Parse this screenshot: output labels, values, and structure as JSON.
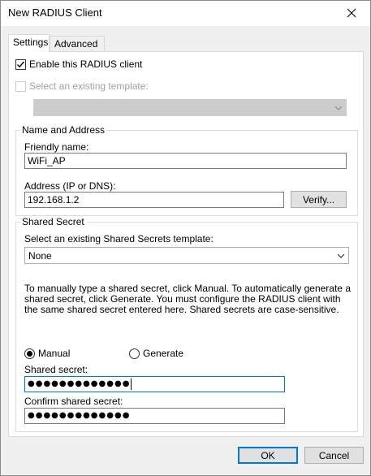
{
  "window": {
    "title": "New RADIUS Client"
  },
  "tabs": [
    {
      "label": "Settings",
      "active": true
    },
    {
      "label": "Advanced",
      "active": false
    }
  ],
  "settings": {
    "enable_client": {
      "label": "Enable this RADIUS client",
      "checked": true
    },
    "existing_template": {
      "label": "Select an existing template:",
      "checked": false,
      "enabled": false,
      "value": ""
    },
    "name_address": {
      "title": "Name and Address",
      "friendly_name_label": "Friendly name:",
      "friendly_name_value": "WiFi_AP",
      "address_label": "Address (IP or DNS):",
      "address_value": "192.168.1.2",
      "verify_label": "Verify..."
    },
    "shared_secret": {
      "title": "Shared Secret",
      "template_label": "Select an existing Shared Secrets template:",
      "template_value": "None",
      "description": "To manually type a shared secret, click Manual. To automatically generate a shared secret, click Generate. You must configure the RADIUS client with the same shared secret entered here. Shared secrets are case-sensitive.",
      "mode_manual": "Manual",
      "mode_generate": "Generate",
      "selected_mode": "Manual",
      "secret_label": "Shared secret:",
      "secret_value": "●●●●●●●●●●●●●",
      "confirm_label": "Confirm shared secret:",
      "confirm_value": "●●●●●●●●●●●●●"
    }
  },
  "footer": {
    "ok_label": "OK",
    "cancel_label": "Cancel"
  },
  "colors": {
    "accent": "#0078d7",
    "dialog_bg": "#f0f0f0",
    "panel_bg": "#ffffff"
  },
  "icons": {
    "close": "close-icon",
    "checkmark": "checkmark-icon",
    "dropdown": "chevron-down-icon"
  }
}
